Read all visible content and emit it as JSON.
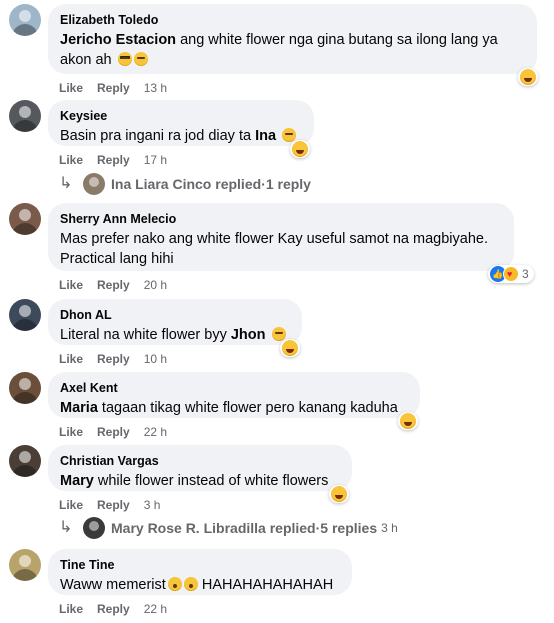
{
  "labels": {
    "like": "Like",
    "reply": "Reply"
  },
  "comments": [
    {
      "author": "Elizabeth Toledo",
      "mention": "Jericho Estacion",
      "text_line1": " ang white flower nga gina butang sa ilong lang ya",
      "text_line2": "akon ah",
      "time": "13 h"
    },
    {
      "author": "Keysiee",
      "text": "Basin pra ingani ra jod diay ta ",
      "mention": "Ina",
      "time": "17 h",
      "replies": {
        "name": "Ina Liara Cinco replied",
        "sep": " · ",
        "count": "1 reply"
      }
    },
    {
      "author": "Sherry Ann Melecio",
      "text_line1": "Mas prefer nako ang white flower Kay useful samot na magbiyahe.",
      "text_line2": "Practical lang hihi",
      "time": "20 h",
      "reaction_count": "3"
    },
    {
      "author": "Dhon AL",
      "text": "Literal na white flower byy ",
      "mention": "Jhon",
      "time": "10 h"
    },
    {
      "author": "Axel Kent",
      "mention": "Maria",
      "text": " tagaan tikag white flower pero kanang kaduha",
      "time": "22 h"
    },
    {
      "author": "Christian Vargas",
      "mention": "Mary",
      "text": " while flower instead of white flowers",
      "time": "3 h",
      "replies": {
        "name": "Mary Rose R. Libradilla replied",
        "sep": " · ",
        "count": "5 replies",
        "time": "3 h"
      }
    },
    {
      "author": "Tine Tine",
      "text_a": "Waww memerist",
      "text_b": " HAHAHAHAHAHAH",
      "time": "22 h"
    }
  ]
}
